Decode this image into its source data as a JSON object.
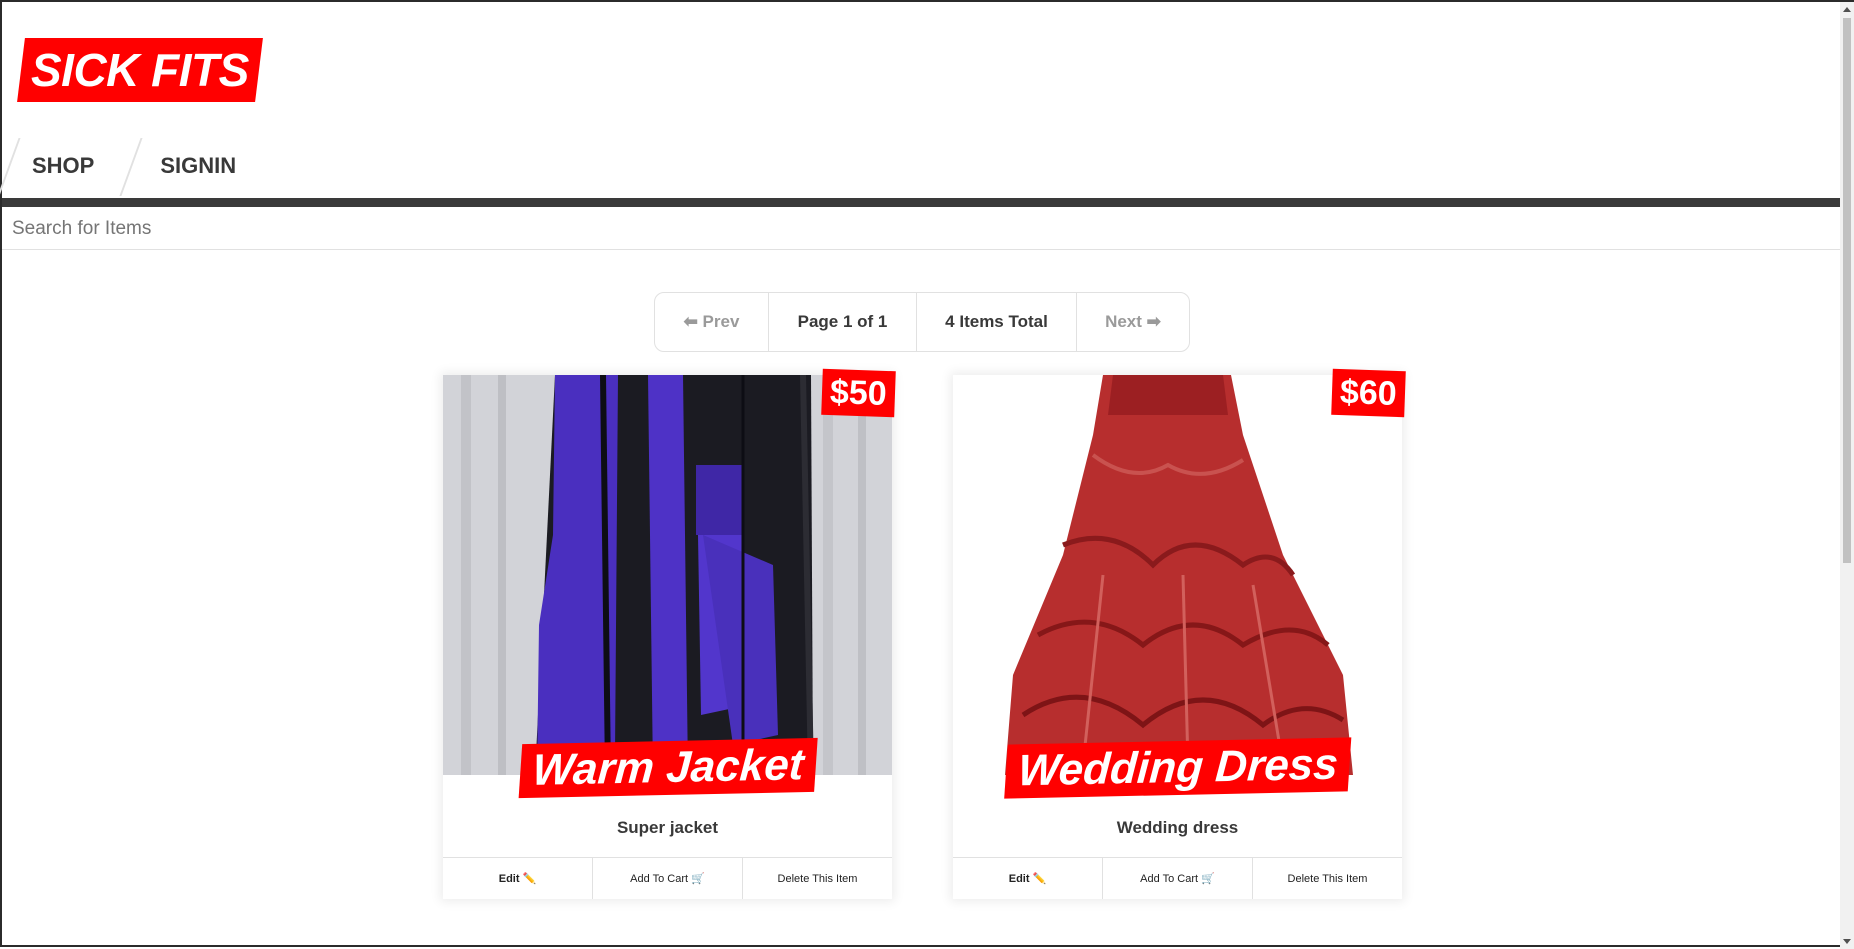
{
  "logo": {
    "text": "SICK FITS"
  },
  "nav": {
    "items": [
      {
        "label": "SHOP"
      },
      {
        "label": "SIGNIN"
      }
    ]
  },
  "search": {
    "placeholder": "Search for Items"
  },
  "pagination": {
    "prev": "⬅ Prev",
    "page": "Page 1 of 1",
    "total": "4 Items Total",
    "next": "Next ➡"
  },
  "items": [
    {
      "title": "Warm Jacket",
      "price": "$50",
      "description": "Super jacket",
      "edit_label": "Edit ✏️",
      "cart_label": "Add To Cart 🛒",
      "delete_label": "Delete This Item"
    },
    {
      "title": "Wedding Dress",
      "price": "$60",
      "description": "Wedding dress",
      "edit_label": "Edit ✏️",
      "cart_label": "Add To Cart 🛒",
      "delete_label": "Delete This Item"
    }
  ],
  "colors": {
    "accent": "#ff0000",
    "header_bar": "#3a3a3a",
    "text": "#393939"
  }
}
